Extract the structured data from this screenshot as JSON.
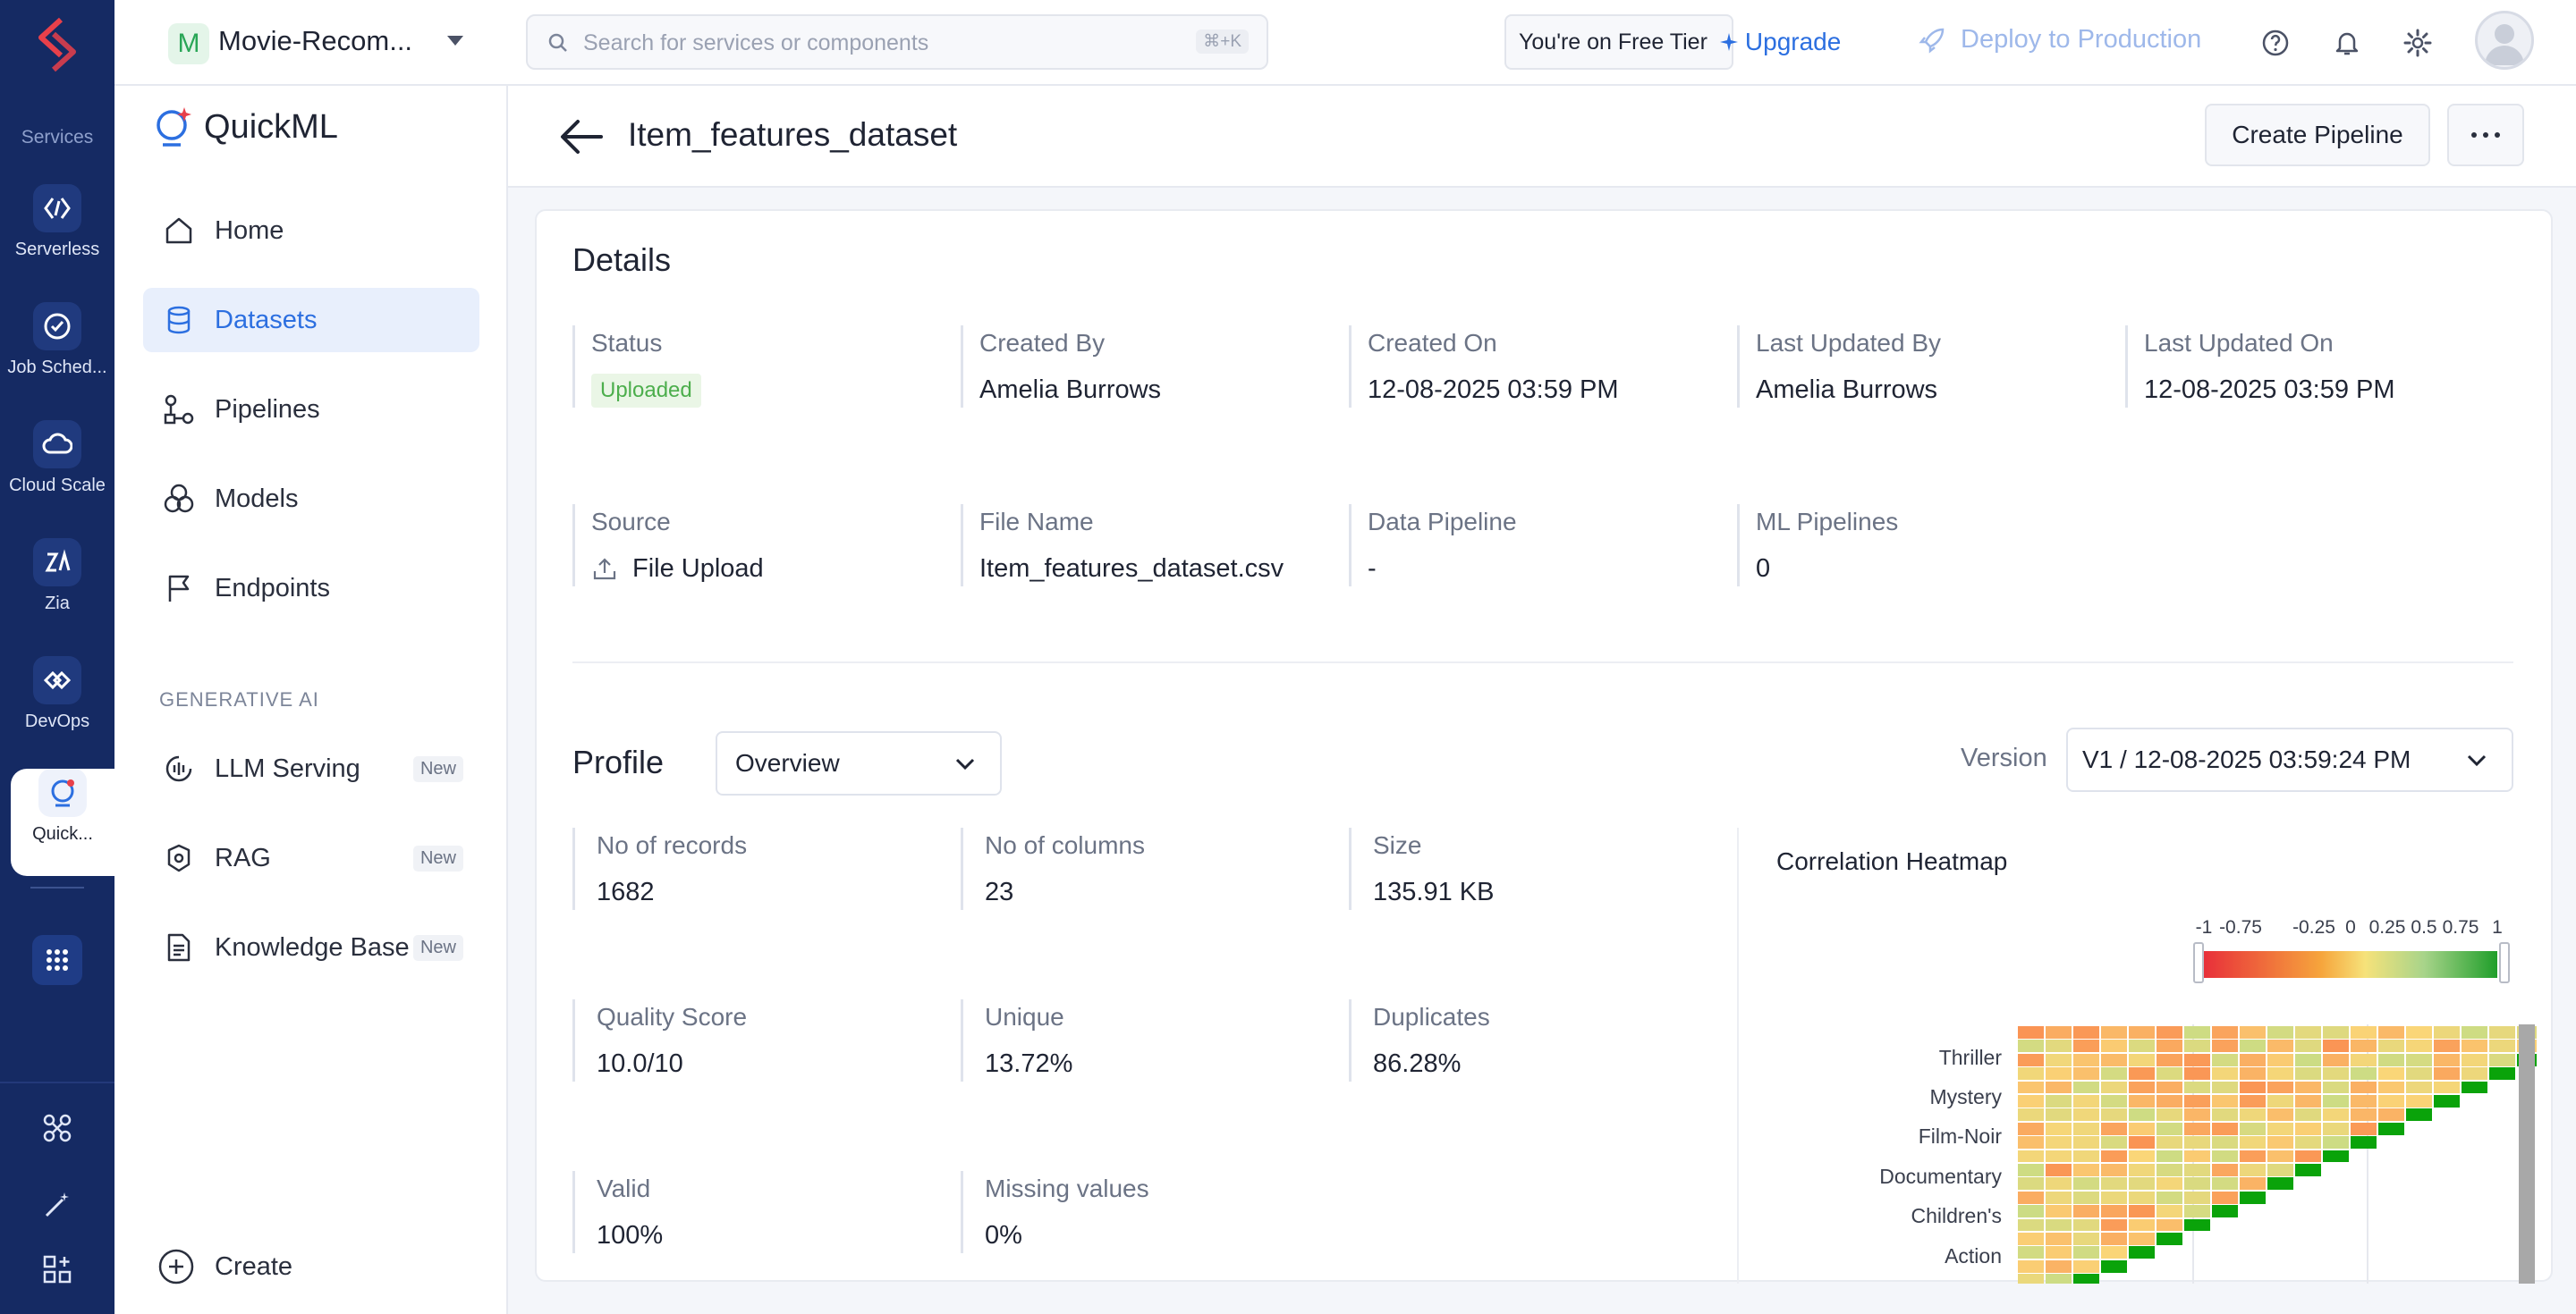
{
  "rail": {
    "section_label": "Services",
    "items": [
      {
        "label": "Serverless",
        "icon": "serverless-icon"
      },
      {
        "label": "Job Sched...",
        "icon": "job-scheduling-icon"
      },
      {
        "label": "Cloud Scale",
        "icon": "cloud-scale-icon"
      },
      {
        "label": "Zia",
        "icon": "zia-icon"
      },
      {
        "label": "DevOps",
        "icon": "devops-icon"
      },
      {
        "label": "Quick...",
        "icon": "quickml-icon"
      }
    ]
  },
  "topbar": {
    "project_initial": "M",
    "project_name": "Movie-Recom...",
    "search_placeholder": "Search for services or components",
    "search_shortcut": "⌘+K",
    "tier_text": "You're on Free Tier",
    "upgrade_label": "Upgrade",
    "deploy_label": "Deploy to Production"
  },
  "sidebar": {
    "brand": "QuickML",
    "nav": [
      {
        "label": "Home",
        "icon": "home-icon"
      },
      {
        "label": "Datasets",
        "icon": "database-icon"
      },
      {
        "label": "Pipelines",
        "icon": "pipelines-icon"
      },
      {
        "label": "Models",
        "icon": "models-icon"
      },
      {
        "label": "Endpoints",
        "icon": "flag-icon"
      }
    ],
    "gen_ai_heading": "GENERATIVE AI",
    "gen_ai": [
      {
        "label": "LLM Serving",
        "badge": "New",
        "icon": "llm-serving-icon"
      },
      {
        "label": "RAG",
        "badge": "New",
        "icon": "rag-icon"
      },
      {
        "label": "Knowledge Base",
        "badge": "New",
        "icon": "document-icon"
      }
    ],
    "create_label": "Create"
  },
  "page": {
    "title": "Item_features_dataset",
    "create_pipeline_label": "Create Pipeline"
  },
  "details": {
    "title": "Details",
    "status_label": "Status",
    "status_value": "Uploaded",
    "created_by_label": "Created By",
    "created_by": "Amelia Burrows",
    "created_on_label": "Created On",
    "created_on": "12-08-2025 03:59 PM",
    "updated_by_label": "Last Updated By",
    "updated_by": "Amelia Burrows",
    "updated_on_label": "Last Updated On",
    "updated_on": "12-08-2025 03:59 PM",
    "source_label": "Source",
    "source_value": "File Upload",
    "file_name_label": "File Name",
    "file_name": "Item_features_dataset.csv",
    "data_pipeline_label": "Data Pipeline",
    "data_pipeline": "-",
    "ml_pipelines_label": "ML Pipelines",
    "ml_pipelines": "0"
  },
  "profile": {
    "title": "Profile",
    "view_selected": "Overview",
    "version_label": "Version",
    "version_selected": "V1 / 12-08-2025 03:59:24 PM",
    "stats": [
      {
        "label": "No of records",
        "value": "1682"
      },
      {
        "label": "No of columns",
        "value": "23"
      },
      {
        "label": "Size",
        "value": "135.91 KB"
      },
      {
        "label": "Quality Score",
        "value": "10.0/10"
      },
      {
        "label": "Unique",
        "value": "13.72%"
      },
      {
        "label": "Duplicates",
        "value": "86.28%"
      },
      {
        "label": "Valid",
        "value": "100%"
      },
      {
        "label": "Missing values",
        "value": "0%"
      }
    ]
  },
  "chart_data": {
    "type": "heatmap",
    "title": "Correlation Heatmap",
    "colorscale_ticks": [
      "-1",
      "-0.75",
      "-0.25",
      "0",
      "0.25",
      "0.5",
      "0.75",
      "1"
    ],
    "colorscale_range": [
      -1,
      1
    ],
    "row_labels_visible": [
      "Thriller",
      "Mystery",
      "Film-Noir",
      "Documentary",
      "Children's",
      "Action"
    ],
    "grid_size": 21,
    "diagonal_value": 1,
    "triangle": "upper",
    "typical_offdiagonal_range": [
      -0.3,
      0.3
    ]
  },
  "colors": {
    "rail_bg": "#152a63",
    "accent": "#2c6fe0",
    "status_green": "#4cae4c",
    "diag_green": "#0a9e0a"
  }
}
